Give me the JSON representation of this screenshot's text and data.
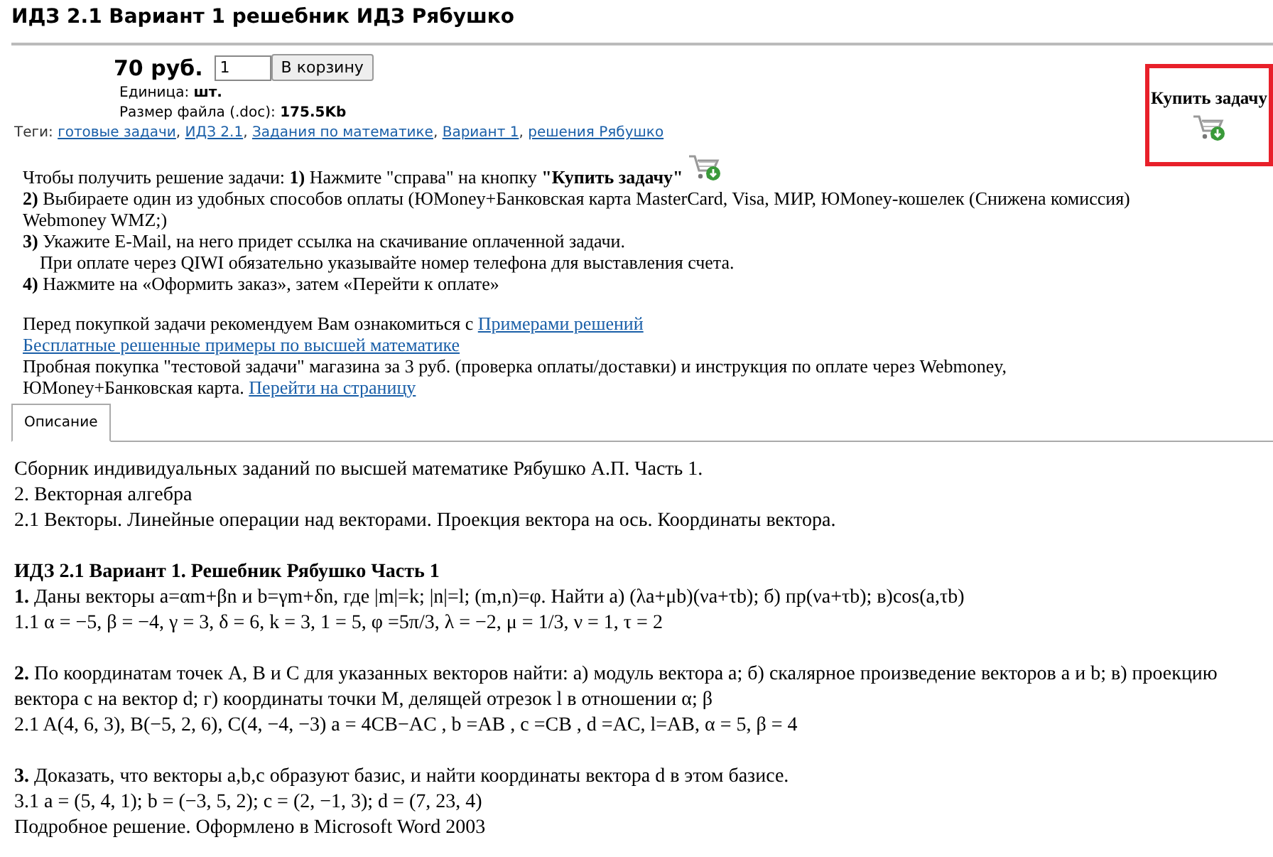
{
  "title": "ИДЗ 2.1 Вариант 1 решебник ИДЗ Рябушко",
  "product": {
    "price": "70 руб.",
    "quantity": "1",
    "cart_button": "В корзину",
    "unit": {
      "label": "Единица:",
      "value": "шт."
    },
    "file_size": {
      "label": "Размер файла (.doc):",
      "value": "175.5Kb"
    },
    "tags": {
      "label": "Теги:",
      "separator": ",",
      "items": [
        "готовые задачи",
        "ИДЗ 2.1",
        "Задания по математике",
        "Вариант 1",
        "решения Рябушко"
      ]
    }
  },
  "buy_box": {
    "label": "Купить задачу"
  },
  "instructions": [
    {
      "text": "Чтобы получить решение задачи: **1)** Нажмите \"справа\" на кнопку **\"Купить задачу\"**",
      "cart_icon": true,
      "indent": false
    },
    {
      "text": "**2)** Выбираете один из удобных способов оплаты (ЮMoney+Банковская карта MasterCard, Visa, МИР, ЮMoney-кошелек (Снижена комиссия) Webmoney WMZ;)",
      "cart_icon": false,
      "indent": false
    },
    {
      "text": "**3)** Укажите E-Mail, на него придет ссылка на скачивание оплаченной задачи.",
      "cart_icon": false,
      "indent": false
    },
    {
      "text": "При оплате через QIWI обязательно указывайте номер телефона для выставления счета.",
      "cart_icon": false,
      "indent": true
    },
    {
      "text": "**4)** Нажмите на «Оформить заказ», затем «Перейти к оплате»",
      "cart_icon": false,
      "indent": false
    }
  ],
  "notes": [
    [
      {
        "kind": "text",
        "text": "Перед покупкой задачи рекомендуем Вам ознакомиться с "
      },
      {
        "kind": "link",
        "text": "Примерами решений"
      }
    ],
    [
      {
        "kind": "link",
        "text": "Бесплатные решенные примеры по высшей математике"
      }
    ],
    [
      {
        "kind": "text",
        "text": "Пробная покупка \"тестовой задачи\" магазина за 3 руб. (проверка оплаты/доставки) и инструкция по оплате через Webmoney, ЮMoney+Банковская карта. "
      },
      {
        "kind": "link",
        "text": "Перейти на страницу"
      }
    ]
  ],
  "tabs": [
    {
      "label": "Описание",
      "selected": true
    }
  ],
  "description": [
    [
      "Сборник индивидуальных заданий по высшей математике Рябушко А.П. Часть 1.",
      "2. Векторная алгебра",
      "2.1 Векторы. Линейные операции над векторами. Проекция вектора на ось. Координаты вектора."
    ],
    [
      "**ИДЗ 2.1 Вариант 1. Решебник Рябушко Часть 1**",
      "**1.** Даны векторы a=αm+βn и b=γm+δn, где |m|=k; |n|=l; (m,n)=φ. Найти а) (λa+μb)(νa+τb); б) пр(νa+τb); в)cos(a,τb)",
      "1.1 α = −5, β = −4, γ = 3, δ = 6, k = 3, 1 = 5, φ =5π/3, λ = −2, μ = 1/3, ν = 1, τ = 2"
    ],
    [
      "**2.** По координатам точек A, B и C для указанных векторов найти: а) модуль вектора a; б) скалярное произведение векторов a и b; в) проекцию вектора c на вектор d; г) координаты точки M, делящей отрезок l в отношении α; β",
      "2.1 A(4, 6, 3), B(−5, 2, 6), C(4, −4, −3) a = 4CB−AC , b =AB , c =CB , d =AC, l=AB, α = 5, β = 4"
    ],
    [
      "**3.** Доказать, что векторы a,b,c образуют базис, и найти координаты вектора d в этом базисе.",
      "3.1 a = (5, 4, 1); b = (−3, 5, 2); c = (2, −1, 3); d = (7, 23, 4)",
      "Подробное решение. Оформлено в Microsoft Word 2003"
    ]
  ]
}
